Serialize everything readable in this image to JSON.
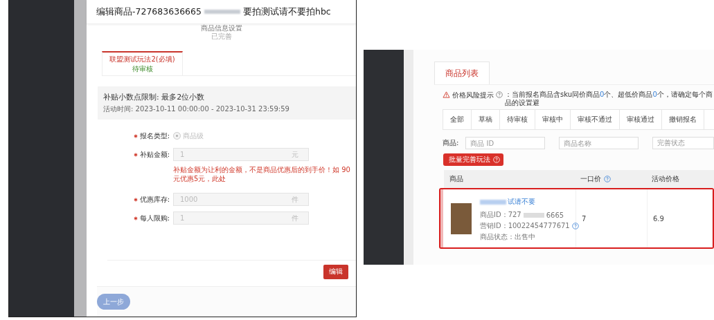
{
  "left": {
    "title_prefix": "编辑商品-727683636665",
    "title_suffix": "要拍测试请不要拍hbc",
    "step": {
      "label": "商品信息设置",
      "status": "已完善"
    },
    "tabs": [
      {
        "label": "联盟测试玩法2(必填)",
        "status": "待审核",
        "selected": true
      }
    ],
    "notice": {
      "rule": "补贴小数点限制: 最多2位小数",
      "time": "活动时间: 2023-10-11 00:00:00 - 2023-10-31 23:59:59"
    },
    "fields": [
      {
        "kind": "radio",
        "label": "报名类型:",
        "required": true,
        "option": "商品级",
        "checked": true,
        "disabled": true
      },
      {
        "kind": "input",
        "label": "补贴金额:",
        "required": true,
        "value": "1",
        "unit": "元",
        "disabled": true,
        "hint": "补贴金额为让利的金额，不是商品优惠后的到手价！如 90元优惠5元，此处"
      },
      {
        "kind": "input",
        "label": "优惠库存:",
        "required": true,
        "value": "1000",
        "unit": "件",
        "disabled": true
      },
      {
        "kind": "input",
        "label": "每人限购:",
        "required": true,
        "value": "1",
        "unit": "件",
        "disabled": true
      }
    ],
    "edit_button": "编辑",
    "back_button": "上一步"
  },
  "right": {
    "tabs": [
      {
        "label": "商品列表",
        "selected": true
      }
    ],
    "risk": {
      "label": "价格风险提示",
      "parts": [
        {
          "text": "：当前报名商品含sku同价商品",
          "highlight": false
        },
        {
          "text": "0",
          "highlight": true
        },
        {
          "text": "个、超低价商品",
          "highlight": false
        },
        {
          "text": "0",
          "highlight": true
        },
        {
          "text": "个，请确定每个商品的设置避",
          "highlight": false
        }
      ]
    },
    "status_tabs": [
      {
        "label": "全部",
        "selected": false
      },
      {
        "label": "草稿",
        "selected": false
      },
      {
        "label": "待审核",
        "selected": false
      },
      {
        "label": "审核中",
        "selected": false
      },
      {
        "label": "审核不通过",
        "selected": false
      },
      {
        "label": "审核通过",
        "selected": false
      },
      {
        "label": "撤销报名",
        "selected": false
      }
    ],
    "filter": {
      "label": "商品:",
      "fields": [
        {
          "kind": "input",
          "placeholder": "商品 ID"
        },
        {
          "kind": "input",
          "placeholder": "商品名称"
        },
        {
          "kind": "select",
          "placeholder": "完善状态"
        }
      ]
    },
    "batch_button": "批量完善玩法",
    "table": {
      "columns": [
        {
          "label": "商品",
          "help": false
        },
        {
          "label": "一口价",
          "help": true
        },
        {
          "label": "活动价格",
          "help": false
        }
      ],
      "rows": [
        {
          "highlighted": true,
          "name": "试请不要",
          "id_label": "商品ID：",
          "id_start": "727",
          "id_end": "6665",
          "marketing_id": "营销ID：10022454777671",
          "status": "商品状态：出售中",
          "price": "7",
          "activity_price": "6.9"
        }
      ]
    }
  }
}
